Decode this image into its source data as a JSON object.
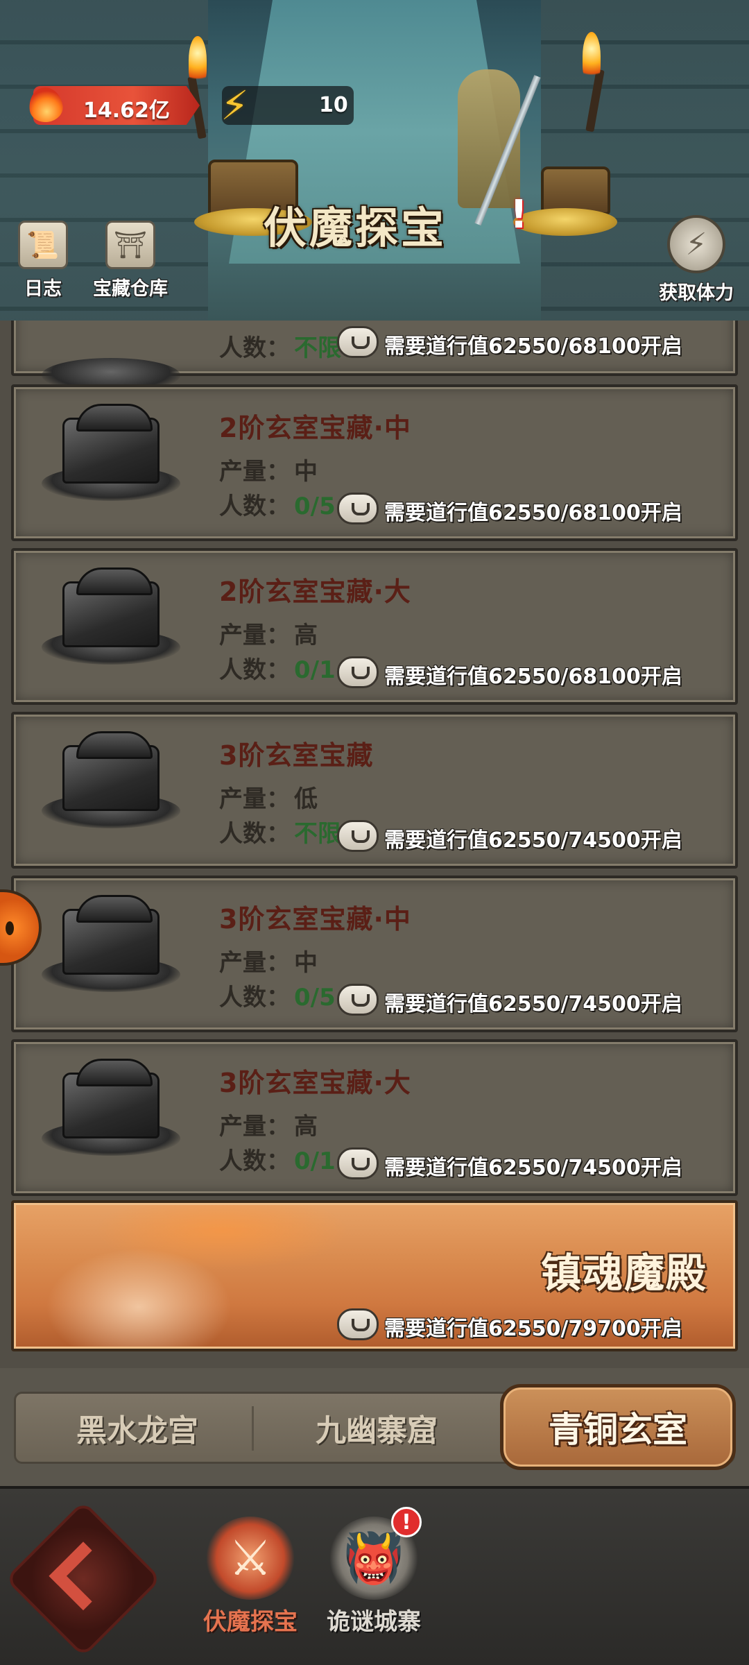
{
  "header": {
    "title": "伏魔探宝",
    "help_symbol": "!",
    "fire_value": "14.62亿",
    "energy_value": "10",
    "left_buttons": [
      {
        "label": "日志",
        "icon": "scroll-icon"
      },
      {
        "label": "宝藏仓库",
        "icon": "warehouse-icon"
      }
    ],
    "right_button": {
      "label": "获取体力",
      "icon": "lightning-icon"
    }
  },
  "labels": {
    "yield": "产量：",
    "people": "人数："
  },
  "cards": [
    {
      "title": "",
      "yield": "",
      "people": "不限",
      "requirement": "需要道行值62550/68100开启"
    },
    {
      "title": "2阶玄室宝藏·中",
      "yield": "中",
      "people": "0/5",
      "requirement": "需要道行值62550/68100开启"
    },
    {
      "title": "2阶玄室宝藏·大",
      "yield": "高",
      "people": "0/1",
      "requirement": "需要道行值62550/68100开启"
    },
    {
      "title": "3阶玄室宝藏",
      "yield": "低",
      "people": "不限",
      "requirement": "需要道行值62550/74500开启"
    },
    {
      "title": "3阶玄室宝藏·中",
      "yield": "中",
      "people": "0/5",
      "requirement": "需要道行值62550/74500开启"
    },
    {
      "title": "3阶玄室宝藏·大",
      "yield": "高",
      "people": "0/1",
      "requirement": "需要道行值62550/74500开启"
    }
  ],
  "special_card": {
    "title": "镇魂魔殿",
    "requirement": "需要道行值62550/79700开启"
  },
  "tabs": [
    {
      "label": "黑水龙宫"
    },
    {
      "label": "九幽寨窟"
    },
    {
      "label": "青铜玄室",
      "active": true
    }
  ],
  "bottom_nav": [
    {
      "label": "伏魔探宝",
      "active": true,
      "icon": "sword-flame-icon"
    },
    {
      "label": "诡谜城寨",
      "active": false,
      "icon": "demon-mask-icon",
      "badge": "!"
    }
  ],
  "colors": {
    "card_title": "#5a1f16",
    "people_value": "#2a6a2f",
    "active_tab": "#a8683a",
    "nav_active_label": "#e5734f"
  }
}
